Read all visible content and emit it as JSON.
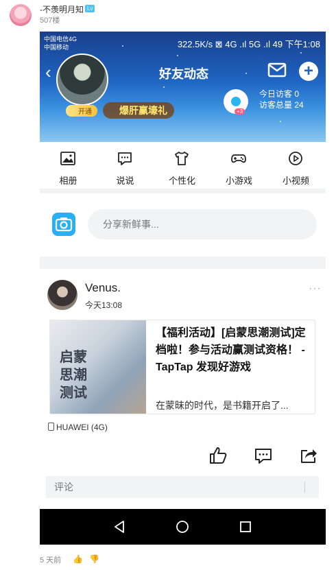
{
  "post": {
    "poster_name": "-不羡明月知",
    "level_badge": "Lv",
    "floor": "507楼",
    "time_ago": "5 天前"
  },
  "phone": {
    "status_left_1": "中国电信4G",
    "status_left_2": "中国移动",
    "status_right": "322.5K/s  ⊠  4G .ıl  5G .ıl  49  下午1:08",
    "page_title": "好友动态",
    "open_vip": "开通",
    "promo": "爆肝赢壕礼",
    "eye_badge": "+3",
    "visits_today": "今日访客  0",
    "visits_total": "访客总量 24",
    "tools": [
      {
        "label": "相册",
        "icon": "photo-icon"
      },
      {
        "label": "说说",
        "icon": "chat-icon"
      },
      {
        "label": "个性化",
        "icon": "shirt-icon"
      },
      {
        "label": "小游戏",
        "icon": "gamepad-icon"
      },
      {
        "label": "小视频",
        "icon": "play-icon"
      }
    ],
    "share_placeholder": "分享新鲜事...",
    "feed": {
      "name": "Venus.",
      "time": "今天13:08",
      "thumb_text": "启蒙思潮测试",
      "link_title": "【福利活动】[启蒙思潮测试]定档啦！参与活动赢测试资格！ - TapTap 发现好游戏",
      "link_desc": "在蒙昧的时代，是书籍开启了...",
      "device": "HUAWEI (4G)",
      "comment_placeholder": "评论"
    }
  },
  "colors": {
    "accent_blue": "#1f65c2",
    "camera_blue": "#2aaef5"
  }
}
